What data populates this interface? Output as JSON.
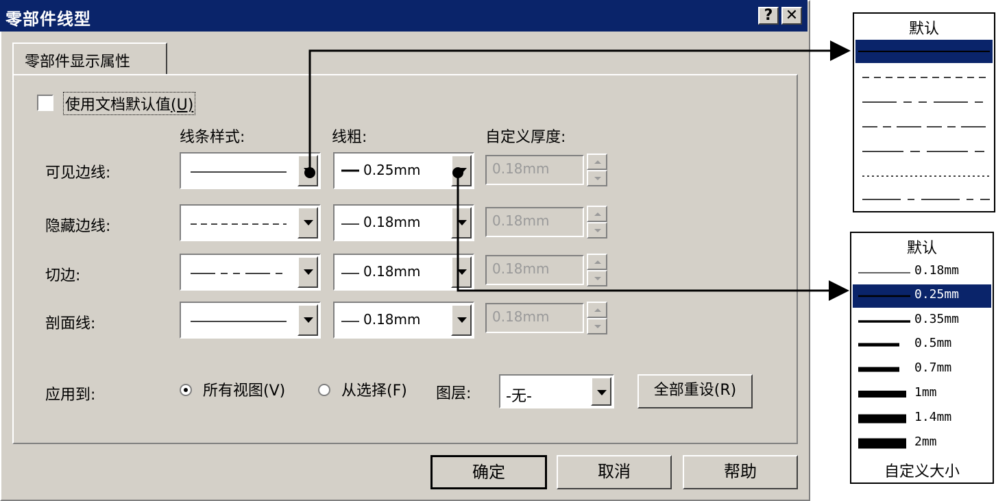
{
  "dialog": {
    "title": "零部件线型",
    "help_button": "?",
    "close_button": "✕",
    "tab_label": "零部件显示属性",
    "use_default_label": "使用文档默认值",
    "use_default_key": "(U)",
    "use_default_checked": false,
    "columns": {
      "style": "线条样式:",
      "weight": "线粗:",
      "custom": "自定义厚度:"
    },
    "rows": [
      {
        "label": "可见边线:",
        "style": "solid",
        "weight": "0.25mm",
        "custom": "0.18mm"
      },
      {
        "label": "隐藏边线:",
        "style": "dashed",
        "weight": "0.18mm",
        "custom": "0.18mm"
      },
      {
        "label": "切边:",
        "style": "longdash",
        "weight": "0.18mm",
        "custom": "0.18mm"
      },
      {
        "label": "剖面线:",
        "style": "solid",
        "weight": "0.18mm",
        "custom": "0.18mm"
      }
    ],
    "apply_to": {
      "label": "应用到:",
      "all_views": "所有视图(V)",
      "from_selection": "从选择(F)",
      "selected": "all_views",
      "layer_label": "图层:",
      "layer_value": "-无-",
      "reset_all": "全部重设(R)"
    },
    "buttons": {
      "ok": "确定",
      "cancel": "取消",
      "help": "帮助"
    }
  },
  "style_popup": {
    "header": "默认",
    "items": [
      "solid",
      "dashed",
      "longdash",
      "dashdash",
      "longshort",
      "dotted",
      "chain"
    ],
    "selected_index": 0
  },
  "weight_popup": {
    "header": "默认",
    "items": [
      "0.18mm",
      "0.25mm",
      "0.35mm",
      "0.5mm",
      "0.7mm",
      "1mm",
      "1.4mm",
      "2mm"
    ],
    "footer": "自定义大小",
    "selected_index": 1
  },
  "colors": {
    "title_bar": "#0a246a",
    "face": "#d4d0c8",
    "selection": "#0a246a"
  }
}
